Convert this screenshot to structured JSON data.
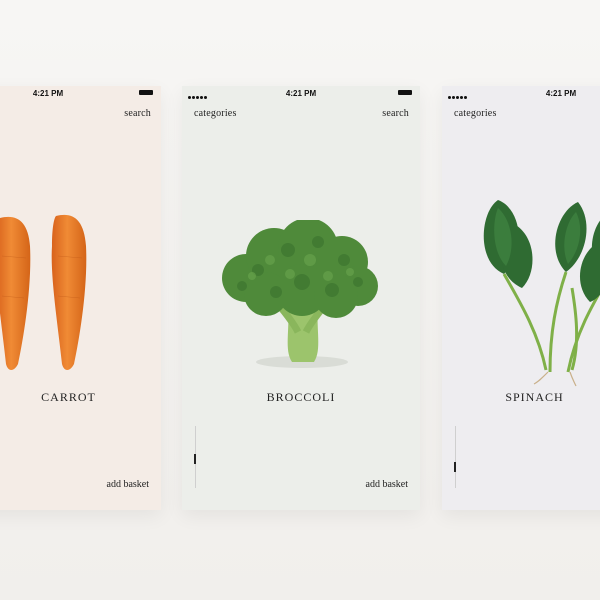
{
  "screens": [
    {
      "id": "carrot",
      "status_time": "4:21 PM",
      "search_label": "search",
      "name": "CARROT",
      "add_label": "add basket"
    },
    {
      "id": "broccoli",
      "status_time": "4:21 PM",
      "categories_label": "categories",
      "search_label": "search",
      "name": "BROCCOLI",
      "add_label": "add basket"
    },
    {
      "id": "spinach",
      "status_time": "4:21 PM",
      "categories_label": "categories",
      "name": "SPINACH"
    }
  ],
  "colors": {
    "carrot_bg": "#f4ece6",
    "broccoli_bg": "#eceeea",
    "spinach_bg": "#eeedf0",
    "carrot_orange": "#e8782a",
    "broccoli_green": "#4f8a3a",
    "spinach_green": "#2f6b32"
  }
}
